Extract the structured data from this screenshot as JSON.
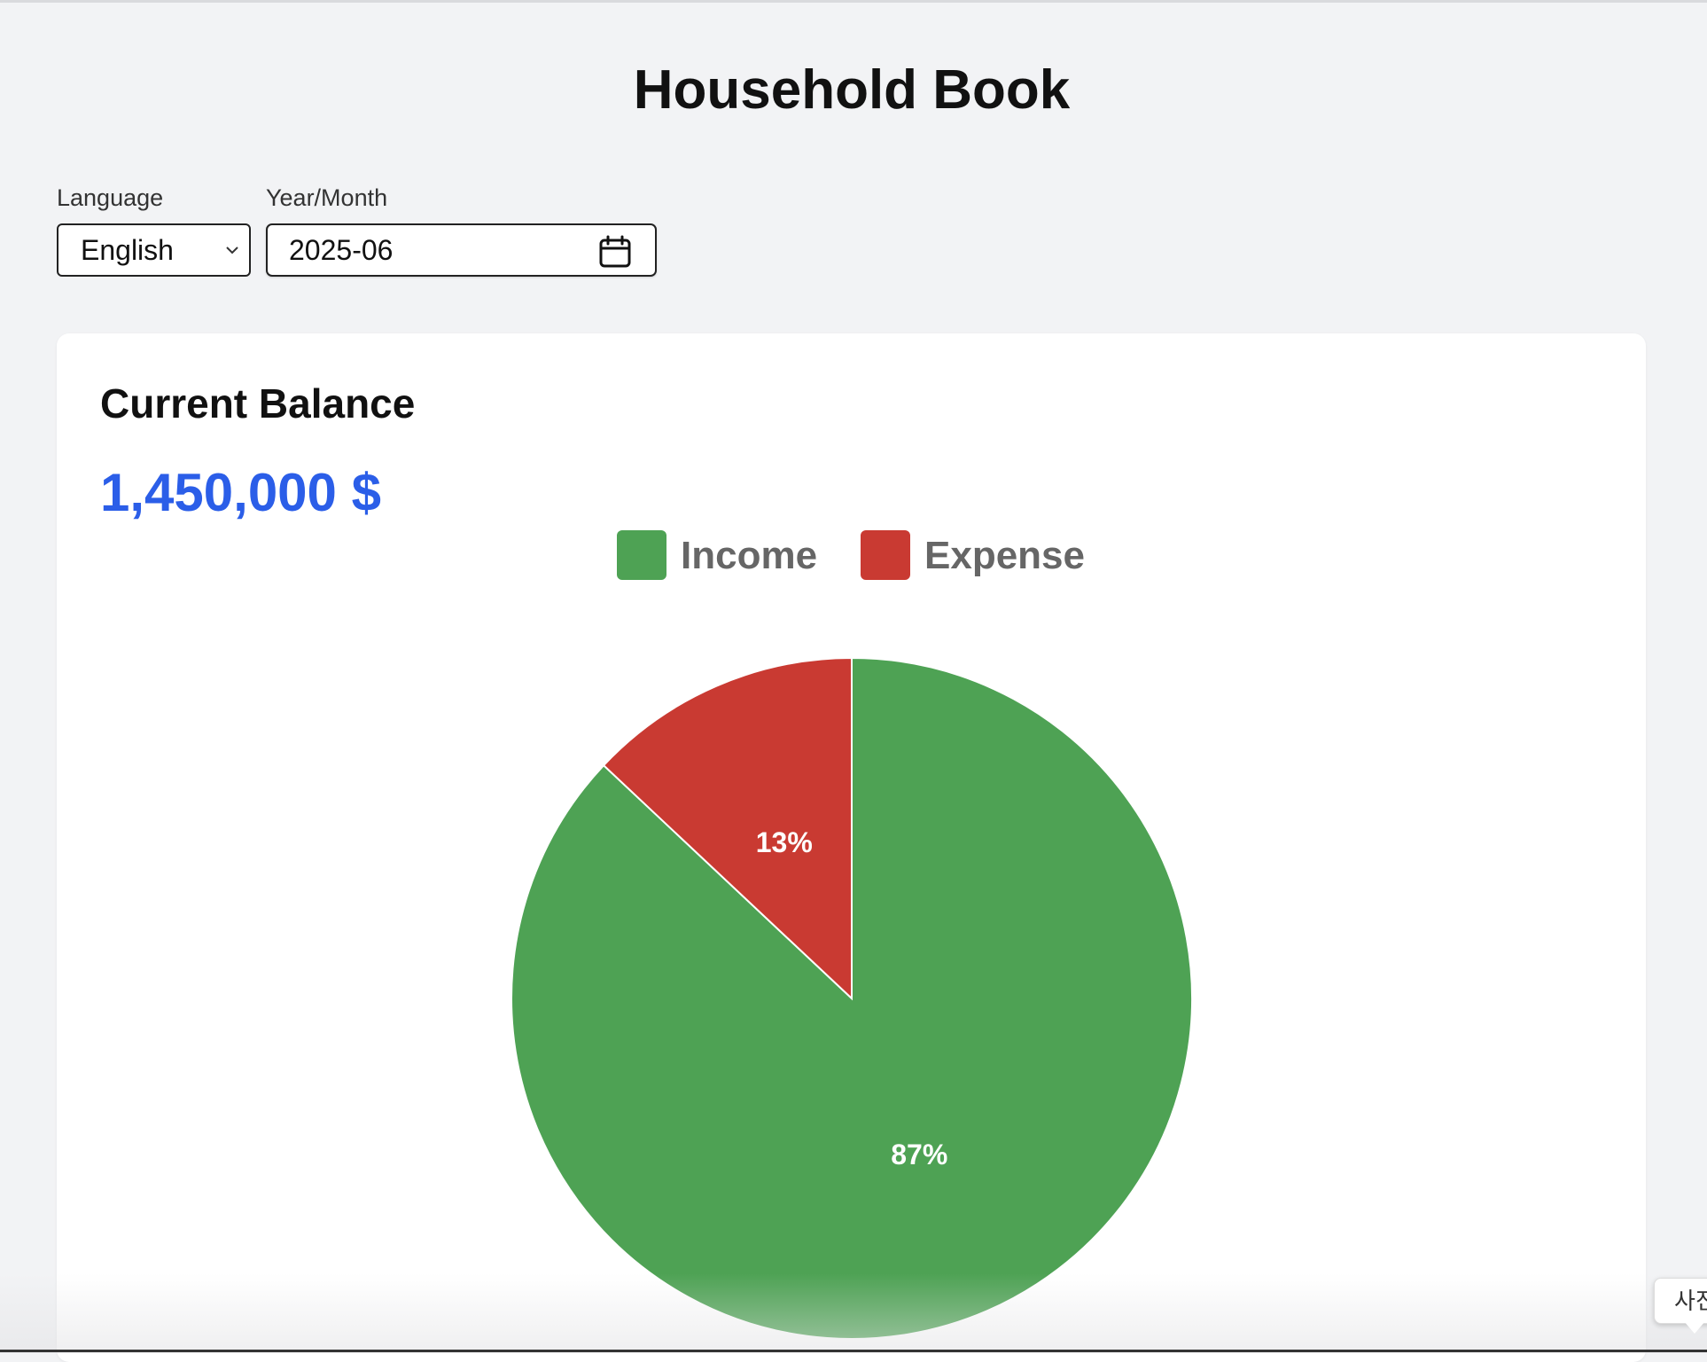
{
  "app": {
    "title": "Household Book"
  },
  "controls": {
    "language_label": "Language",
    "language_value": "English",
    "yearmonth_label": "Year/Month",
    "yearmonth_value": "2025-06"
  },
  "balance_card": {
    "title": "Current Balance",
    "amount": "1,450,000 $"
  },
  "icons": {
    "language_dropdown": "chevron-down-icon",
    "date_picker": "calendar-icon"
  },
  "colors": {
    "accent_blue": "#2b5ee8",
    "income_green": "#4ea254",
    "expense_red": "#c93a32"
  },
  "chart_data": {
    "type": "pie",
    "legend_position": "top-center",
    "categories": [
      "Income",
      "Expense"
    ],
    "values": [
      87,
      13
    ],
    "labels": [
      "87%",
      "13%"
    ],
    "colors": [
      "#4ea254",
      "#c93a32"
    ]
  },
  "tooltip": {
    "text": "사진"
  }
}
